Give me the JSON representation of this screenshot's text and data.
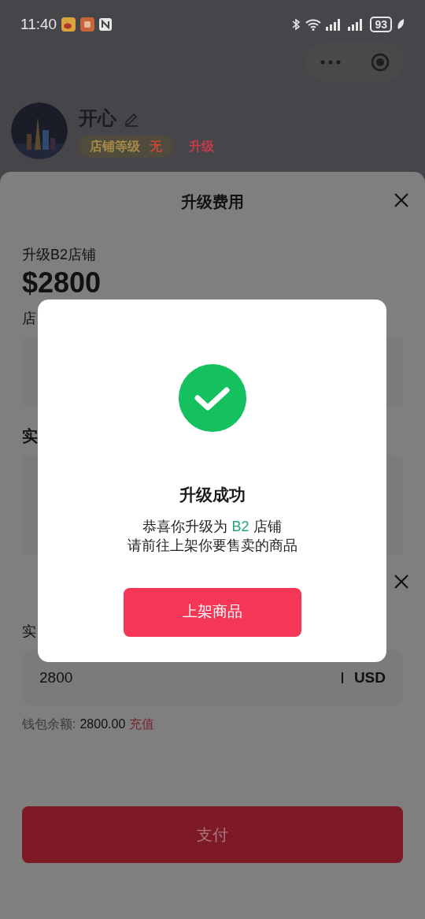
{
  "status_bar": {
    "time": "11:40",
    "battery": "93"
  },
  "profile": {
    "name": "开心",
    "level_label": "店铺等级",
    "level_value": "无",
    "upgrade_link": "升级"
  },
  "sheet": {
    "title": "升级费用",
    "plan_label": "升级B2店铺",
    "price": "$2800",
    "fragments": [
      "店",
      "实"
    ],
    "amount_fragment": "实",
    "amount": {
      "value": "2800",
      "currency": "USD"
    },
    "balance_label": "钱包余额:",
    "balance": "2800.00",
    "recharge_link": "充值",
    "pay_button": "支付"
  },
  "dialog": {
    "title": "升级成功",
    "message_prefix": "恭喜你升级为",
    "message_highlight": "B2",
    "message_suffix": "店铺",
    "message_line_2": "请前往上架你要售卖的商品",
    "button": "上架商品"
  }
}
